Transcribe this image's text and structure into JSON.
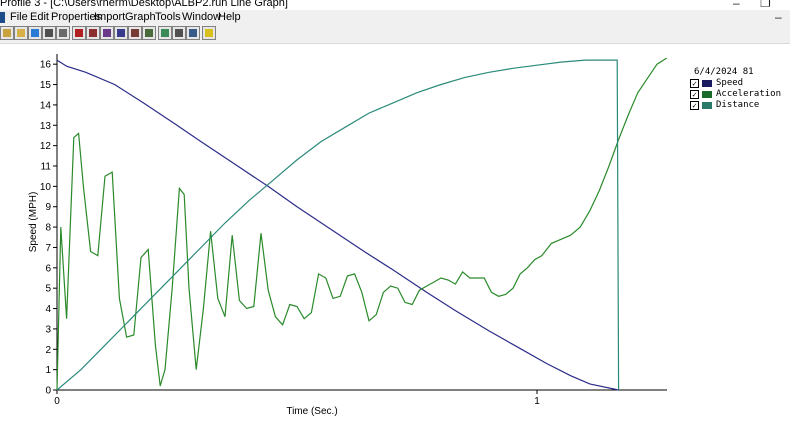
{
  "window": {
    "title": "Profile 3 - [C:\\Users\\rherm\\Desktop\\ALBP2.run Line Graph]"
  },
  "menu": {
    "items": [
      "File",
      "Edit",
      "Properties",
      "Import",
      "Graph",
      "Tools",
      "Window",
      "Help"
    ]
  },
  "toolbar": {
    "buttons": [
      {
        "icon": "open-folder-icon",
        "color": "#c8a23c"
      },
      {
        "icon": "folder-icon",
        "color": "#d8b04a"
      },
      {
        "icon": "runner-icon",
        "color": "#2a7bd4"
      },
      {
        "icon": "printer-icon",
        "color": "#505050"
      },
      {
        "icon": "print-preview-icon",
        "color": "#6a6a6a"
      },
      {
        "icon": "car-icon",
        "color": "#b02020"
      },
      {
        "icon": "table-icon",
        "color": "#8a3030"
      },
      {
        "icon": "grid-icon",
        "color": "#6a3a8a"
      },
      {
        "icon": "list-icon",
        "color": "#3a3a8a"
      },
      {
        "icon": "graph-table-icon",
        "color": "#7a3a3a"
      },
      {
        "icon": "graph-icon",
        "color": "#4a6a3a"
      },
      {
        "icon": "refresh-icon",
        "color": "#3a8a5a"
      },
      {
        "icon": "copy-icon",
        "color": "#505050"
      },
      {
        "icon": "monitor-icon",
        "color": "#3a5a8a"
      },
      {
        "icon": "help-icon",
        "color": "#d8c020"
      }
    ]
  },
  "legend": {
    "title": "6/4/2024 81",
    "items": [
      {
        "label": "Speed",
        "color": "#1a1a60",
        "checked": true
      },
      {
        "label": "Acceleration",
        "color": "#1a6a2a",
        "checked": true
      },
      {
        "label": "Distance",
        "color": "#2a7a6a",
        "checked": true
      }
    ]
  },
  "chart_data": {
    "type": "line",
    "xlabel": "Time (Sec.)",
    "ylabel": "Speed (MPH)",
    "xlim": [
      0,
      1.27
    ],
    "ylim": [
      0,
      16.5
    ],
    "x_ticks": [
      0,
      1
    ],
    "y_ticks": [
      0,
      1,
      2,
      3,
      4,
      5,
      6,
      7,
      8,
      9,
      10,
      11,
      12,
      13,
      14,
      15,
      16
    ],
    "grid": false,
    "legend_position": "top-right",
    "series": [
      {
        "name": "Speed",
        "color": "#2b2b8a",
        "x": [
          0,
          0.02,
          0.06,
          0.12,
          0.18,
          0.25,
          0.3,
          0.37,
          0.44,
          0.5,
          0.57,
          0.64,
          0.7,
          0.77,
          0.83,
          0.9,
          0.96,
          1.02,
          1.07,
          1.11,
          1.17
        ],
        "y": [
          16.2,
          15.9,
          15.6,
          15.0,
          14.1,
          13.0,
          12.2,
          11.1,
          10.0,
          9.0,
          7.9,
          6.8,
          5.9,
          4.8,
          3.9,
          2.9,
          2.1,
          1.3,
          0.7,
          0.3,
          0
        ]
      },
      {
        "name": "Acceleration",
        "color": "#2a8a2a",
        "x": [
          0,
          0.008,
          0.02,
          0.035,
          0.045,
          0.055,
          0.07,
          0.085,
          0.1,
          0.115,
          0.13,
          0.145,
          0.16,
          0.175,
          0.19,
          0.205,
          0.215,
          0.225,
          0.24,
          0.255,
          0.265,
          0.275,
          0.29,
          0.305,
          0.32,
          0.335,
          0.35,
          0.365,
          0.38,
          0.395,
          0.41,
          0.425,
          0.44,
          0.455,
          0.47,
          0.485,
          0.5,
          0.515,
          0.53,
          0.545,
          0.56,
          0.575,
          0.59,
          0.605,
          0.62,
          0.635,
          0.65,
          0.665,
          0.68,
          0.695,
          0.71,
          0.725,
          0.74,
          0.755,
          0.77,
          0.785,
          0.8,
          0.815,
          0.83,
          0.845,
          0.86,
          0.875,
          0.89,
          0.905,
          0.92,
          0.935,
          0.95,
          0.965,
          0.98,
          0.995,
          1.01,
          1.03,
          1.05,
          1.07,
          1.09,
          1.11,
          1.13,
          1.15,
          1.17,
          1.19,
          1.21,
          1.23,
          1.25,
          1.27
        ],
        "y": [
          0,
          8.0,
          3.5,
          12.4,
          12.6,
          10.0,
          6.8,
          6.6,
          10.5,
          10.7,
          4.5,
          2.6,
          2.7,
          6.5,
          6.9,
          2.2,
          0.2,
          1.0,
          5.0,
          9.9,
          9.6,
          5.0,
          1.0,
          4.0,
          7.8,
          4.5,
          3.6,
          7.6,
          4.4,
          4.0,
          4.1,
          7.7,
          4.9,
          3.6,
          3.2,
          4.2,
          4.1,
          3.5,
          3.8,
          5.7,
          5.5,
          4.5,
          4.6,
          5.6,
          5.7,
          4.8,
          3.4,
          3.7,
          4.8,
          5.1,
          5.0,
          4.3,
          4.2,
          4.9,
          5.1,
          5.3,
          5.5,
          5.4,
          5.2,
          5.8,
          5.5,
          5.5,
          5.5,
          4.8,
          4.6,
          4.7,
          5.0,
          5.7,
          6.0,
          6.4,
          6.6,
          7.2,
          7.4,
          7.6,
          8.0,
          8.8,
          9.8,
          11.0,
          12.3,
          13.5,
          14.6,
          15.3,
          16.0,
          16.3
        ]
      },
      {
        "name": "Distance",
        "color": "#2a8a7a",
        "x": [
          0,
          0.05,
          0.1,
          0.15,
          0.2,
          0.25,
          0.3,
          0.35,
          0.4,
          0.45,
          0.5,
          0.55,
          0.6,
          0.65,
          0.7,
          0.75,
          0.8,
          0.85,
          0.9,
          0.95,
          1.0,
          1.05,
          1.1,
          1.16,
          1.167,
          1.17
        ],
        "y": [
          0,
          1.0,
          2.2,
          3.4,
          4.6,
          5.8,
          7.0,
          8.2,
          9.3,
          10.3,
          11.3,
          12.2,
          12.9,
          13.6,
          14.1,
          14.6,
          15.0,
          15.35,
          15.6,
          15.8,
          15.95,
          16.1,
          16.2,
          16.2,
          16.2,
          0
        ]
      }
    ]
  }
}
